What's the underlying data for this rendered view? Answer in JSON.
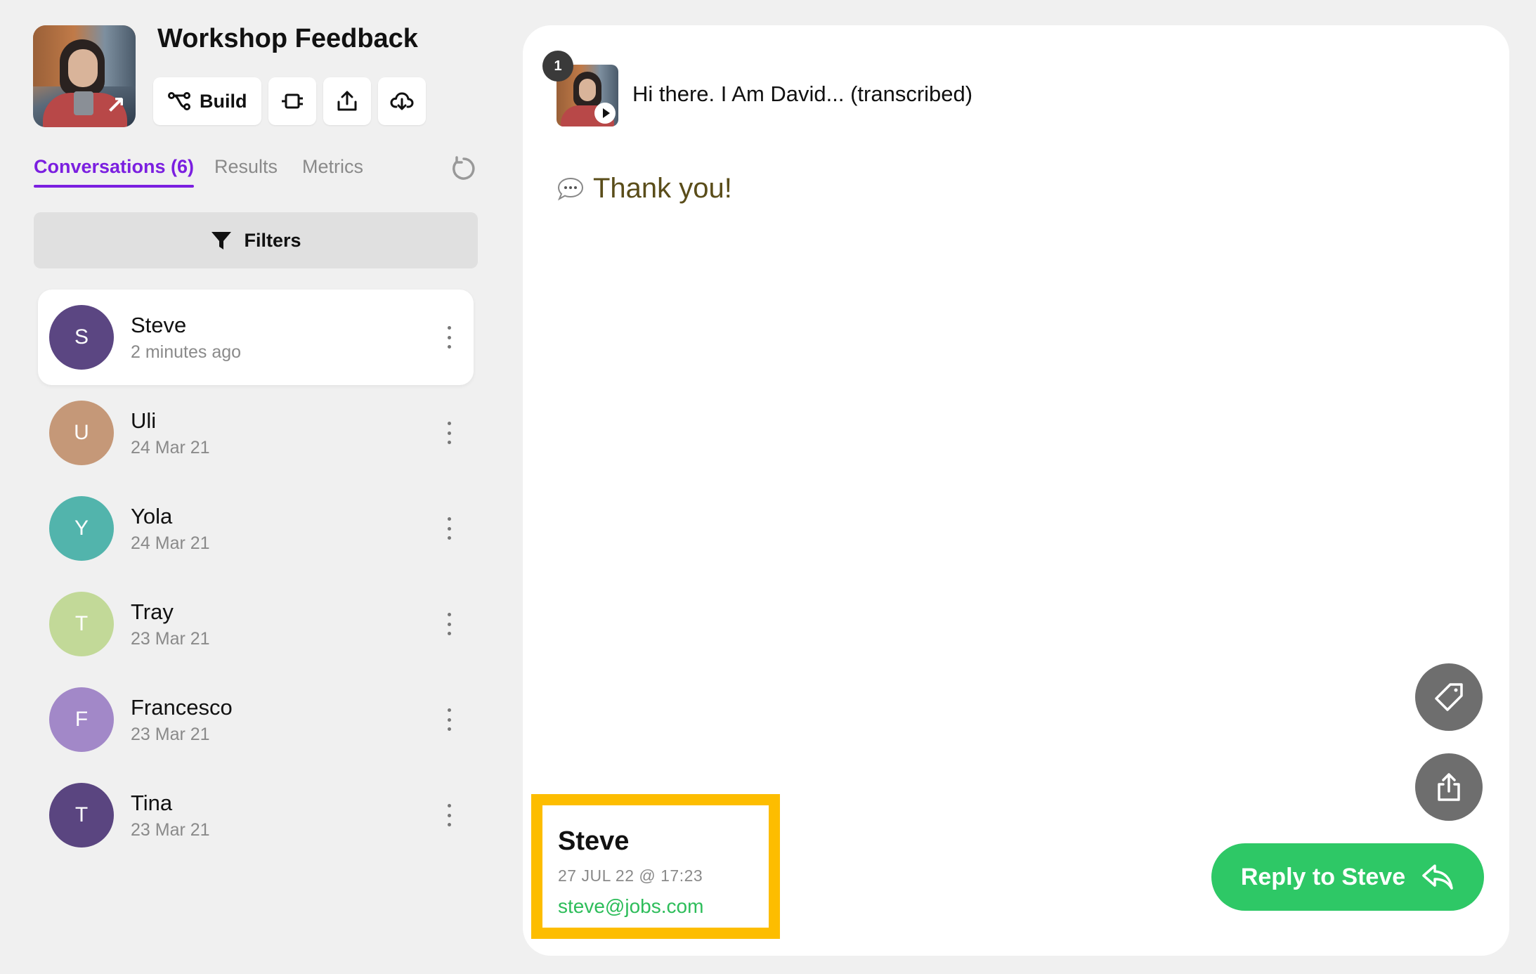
{
  "header": {
    "title": "Workshop Feedback",
    "build_label": "Build"
  },
  "tabs": [
    {
      "label": "Conversations (6)",
      "active": true
    },
    {
      "label": "Results",
      "active": false
    },
    {
      "label": "Metrics",
      "active": false
    }
  ],
  "filters_label": "Filters",
  "conversations": [
    {
      "initial": "S",
      "name": "Steve",
      "date": "2 minutes ago",
      "color": "#5b4682",
      "selected": true
    },
    {
      "initial": "U",
      "name": "Uli",
      "date": "24 Mar 21",
      "color": "#c59878"
    },
    {
      "initial": "Y",
      "name": "Yola",
      "date": "24 Mar 21",
      "color": "#52b4ac"
    },
    {
      "initial": "T",
      "name": "Tray",
      "date": "23 Mar 21",
      "color": "#c2d998"
    },
    {
      "initial": "F",
      "name": "Francesco",
      "date": "23 Mar 21",
      "color": "#a288c8"
    },
    {
      "initial": "T",
      "name": "Tina",
      "date": "23 Mar 21",
      "color": "#5a4580"
    }
  ],
  "message": {
    "badge": "1",
    "title": "Hi there. I Am David... (transcribed)",
    "reply": "Thank you!"
  },
  "contact": {
    "name": "Steve",
    "date": "27 JUL 22 @ 17:23",
    "email": "steve@jobs.com"
  },
  "reply_button_label": "Reply to Steve",
  "colors": {
    "accent": "#7b1fe0",
    "reply_green": "#2ec866",
    "highlight": "#fdbd00"
  }
}
